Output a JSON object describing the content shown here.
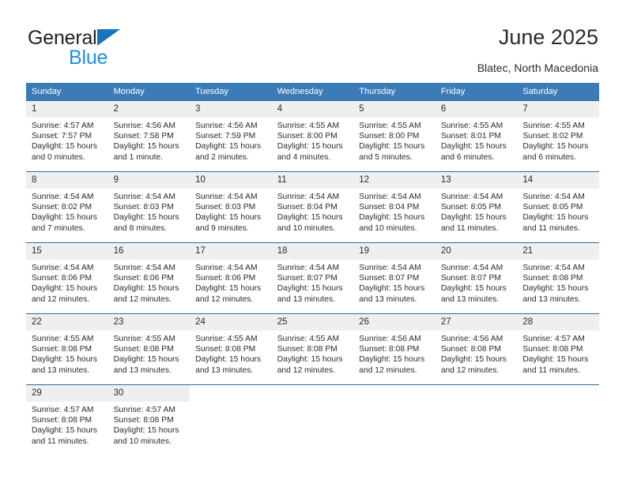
{
  "brand": {
    "name_part1": "General",
    "name_part2": "Blue",
    "logo_icon": "triangle-flag-icon",
    "accent_color": "#1676bd",
    "secondary_color": "#1a8fe0"
  },
  "header": {
    "title": "June 2025",
    "location": "Blatec, North Macedonia"
  },
  "theme": {
    "header_bg": "#3b7cb8",
    "row_border": "#2d6ba5",
    "daynum_bg": "#efefef",
    "text": "#2b2b2b"
  },
  "weekdays": [
    "Sunday",
    "Monday",
    "Tuesday",
    "Wednesday",
    "Thursday",
    "Friday",
    "Saturday"
  ],
  "weeks": [
    [
      {
        "day": "1",
        "sunrise": "Sunrise: 4:57 AM",
        "sunset": "Sunset: 7:57 PM",
        "daylight_1": "Daylight: 15 hours",
        "daylight_2": "and 0 minutes."
      },
      {
        "day": "2",
        "sunrise": "Sunrise: 4:56 AM",
        "sunset": "Sunset: 7:58 PM",
        "daylight_1": "Daylight: 15 hours",
        "daylight_2": "and 1 minute."
      },
      {
        "day": "3",
        "sunrise": "Sunrise: 4:56 AM",
        "sunset": "Sunset: 7:59 PM",
        "daylight_1": "Daylight: 15 hours",
        "daylight_2": "and 2 minutes."
      },
      {
        "day": "4",
        "sunrise": "Sunrise: 4:55 AM",
        "sunset": "Sunset: 8:00 PM",
        "daylight_1": "Daylight: 15 hours",
        "daylight_2": "and 4 minutes."
      },
      {
        "day": "5",
        "sunrise": "Sunrise: 4:55 AM",
        "sunset": "Sunset: 8:00 PM",
        "daylight_1": "Daylight: 15 hours",
        "daylight_2": "and 5 minutes."
      },
      {
        "day": "6",
        "sunrise": "Sunrise: 4:55 AM",
        "sunset": "Sunset: 8:01 PM",
        "daylight_1": "Daylight: 15 hours",
        "daylight_2": "and 6 minutes."
      },
      {
        "day": "7",
        "sunrise": "Sunrise: 4:55 AM",
        "sunset": "Sunset: 8:02 PM",
        "daylight_1": "Daylight: 15 hours",
        "daylight_2": "and 6 minutes."
      }
    ],
    [
      {
        "day": "8",
        "sunrise": "Sunrise: 4:54 AM",
        "sunset": "Sunset: 8:02 PM",
        "daylight_1": "Daylight: 15 hours",
        "daylight_2": "and 7 minutes."
      },
      {
        "day": "9",
        "sunrise": "Sunrise: 4:54 AM",
        "sunset": "Sunset: 8:03 PM",
        "daylight_1": "Daylight: 15 hours",
        "daylight_2": "and 8 minutes."
      },
      {
        "day": "10",
        "sunrise": "Sunrise: 4:54 AM",
        "sunset": "Sunset: 8:03 PM",
        "daylight_1": "Daylight: 15 hours",
        "daylight_2": "and 9 minutes."
      },
      {
        "day": "11",
        "sunrise": "Sunrise: 4:54 AM",
        "sunset": "Sunset: 8:04 PM",
        "daylight_1": "Daylight: 15 hours",
        "daylight_2": "and 10 minutes."
      },
      {
        "day": "12",
        "sunrise": "Sunrise: 4:54 AM",
        "sunset": "Sunset: 8:04 PM",
        "daylight_1": "Daylight: 15 hours",
        "daylight_2": "and 10 minutes."
      },
      {
        "day": "13",
        "sunrise": "Sunrise: 4:54 AM",
        "sunset": "Sunset: 8:05 PM",
        "daylight_1": "Daylight: 15 hours",
        "daylight_2": "and 11 minutes."
      },
      {
        "day": "14",
        "sunrise": "Sunrise: 4:54 AM",
        "sunset": "Sunset: 8:05 PM",
        "daylight_1": "Daylight: 15 hours",
        "daylight_2": "and 11 minutes."
      }
    ],
    [
      {
        "day": "15",
        "sunrise": "Sunrise: 4:54 AM",
        "sunset": "Sunset: 8:06 PM",
        "daylight_1": "Daylight: 15 hours",
        "daylight_2": "and 12 minutes."
      },
      {
        "day": "16",
        "sunrise": "Sunrise: 4:54 AM",
        "sunset": "Sunset: 8:06 PM",
        "daylight_1": "Daylight: 15 hours",
        "daylight_2": "and 12 minutes."
      },
      {
        "day": "17",
        "sunrise": "Sunrise: 4:54 AM",
        "sunset": "Sunset: 8:06 PM",
        "daylight_1": "Daylight: 15 hours",
        "daylight_2": "and 12 minutes."
      },
      {
        "day": "18",
        "sunrise": "Sunrise: 4:54 AM",
        "sunset": "Sunset: 8:07 PM",
        "daylight_1": "Daylight: 15 hours",
        "daylight_2": "and 13 minutes."
      },
      {
        "day": "19",
        "sunrise": "Sunrise: 4:54 AM",
        "sunset": "Sunset: 8:07 PM",
        "daylight_1": "Daylight: 15 hours",
        "daylight_2": "and 13 minutes."
      },
      {
        "day": "20",
        "sunrise": "Sunrise: 4:54 AM",
        "sunset": "Sunset: 8:07 PM",
        "daylight_1": "Daylight: 15 hours",
        "daylight_2": "and 13 minutes."
      },
      {
        "day": "21",
        "sunrise": "Sunrise: 4:54 AM",
        "sunset": "Sunset: 8:08 PM",
        "daylight_1": "Daylight: 15 hours",
        "daylight_2": "and 13 minutes."
      }
    ],
    [
      {
        "day": "22",
        "sunrise": "Sunrise: 4:55 AM",
        "sunset": "Sunset: 8:08 PM",
        "daylight_1": "Daylight: 15 hours",
        "daylight_2": "and 13 minutes."
      },
      {
        "day": "23",
        "sunrise": "Sunrise: 4:55 AM",
        "sunset": "Sunset: 8:08 PM",
        "daylight_1": "Daylight: 15 hours",
        "daylight_2": "and 13 minutes."
      },
      {
        "day": "24",
        "sunrise": "Sunrise: 4:55 AM",
        "sunset": "Sunset: 8:08 PM",
        "daylight_1": "Daylight: 15 hours",
        "daylight_2": "and 13 minutes."
      },
      {
        "day": "25",
        "sunrise": "Sunrise: 4:55 AM",
        "sunset": "Sunset: 8:08 PM",
        "daylight_1": "Daylight: 15 hours",
        "daylight_2": "and 12 minutes."
      },
      {
        "day": "26",
        "sunrise": "Sunrise: 4:56 AM",
        "sunset": "Sunset: 8:08 PM",
        "daylight_1": "Daylight: 15 hours",
        "daylight_2": "and 12 minutes."
      },
      {
        "day": "27",
        "sunrise": "Sunrise: 4:56 AM",
        "sunset": "Sunset: 8:08 PM",
        "daylight_1": "Daylight: 15 hours",
        "daylight_2": "and 12 minutes."
      },
      {
        "day": "28",
        "sunrise": "Sunrise: 4:57 AM",
        "sunset": "Sunset: 8:08 PM",
        "daylight_1": "Daylight: 15 hours",
        "daylight_2": "and 11 minutes."
      }
    ],
    [
      {
        "day": "29",
        "sunrise": "Sunrise: 4:57 AM",
        "sunset": "Sunset: 8:08 PM",
        "daylight_1": "Daylight: 15 hours",
        "daylight_2": "and 11 minutes."
      },
      {
        "day": "30",
        "sunrise": "Sunrise: 4:57 AM",
        "sunset": "Sunset: 8:08 PM",
        "daylight_1": "Daylight: 15 hours",
        "daylight_2": "and 10 minutes."
      },
      null,
      null,
      null,
      null,
      null
    ]
  ]
}
